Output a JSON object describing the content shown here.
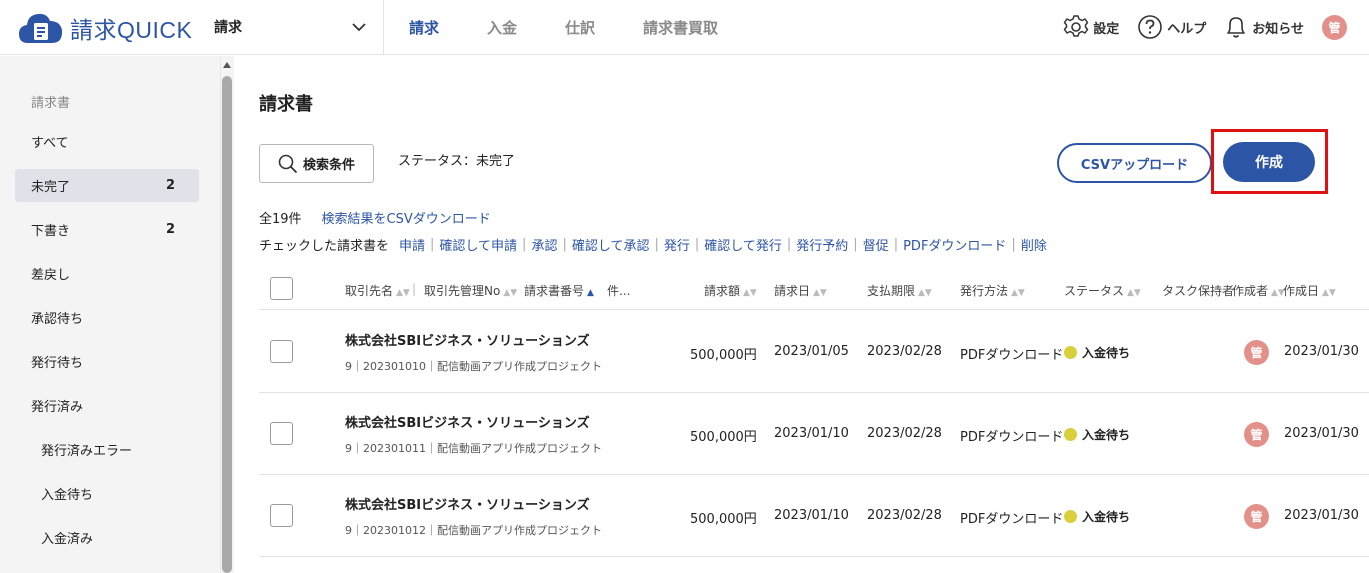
{
  "brand": {
    "name": "請求QUICK"
  },
  "app_select": {
    "label": "請求"
  },
  "nav": [
    {
      "label": "請求",
      "active": true
    },
    {
      "label": "入金",
      "active": false
    },
    {
      "label": "仕訳",
      "active": false
    },
    {
      "label": "請求書買取",
      "active": false
    }
  ],
  "top_right": {
    "settings": "設定",
    "help": "ヘルプ",
    "notifications": "お知らせ",
    "avatar": "管"
  },
  "sidebar": {
    "heading": "請求書",
    "items": [
      {
        "label": "すべて",
        "count": ""
      },
      {
        "label": "未完了",
        "count": "2",
        "active": true
      },
      {
        "label": "下書き",
        "count": "2"
      },
      {
        "label": "差戻し",
        "count": ""
      },
      {
        "label": "承認待ち",
        "count": ""
      },
      {
        "label": "発行待ち",
        "count": ""
      },
      {
        "label": "発行済み",
        "count": ""
      },
      {
        "label": "発行済みエラー",
        "count": "",
        "sub": true
      },
      {
        "label": "入金待ち",
        "count": "",
        "sub": true
      },
      {
        "label": "入金済み",
        "count": "",
        "sub": true
      }
    ]
  },
  "main": {
    "title": "請求書",
    "search_button": "検索条件",
    "status_filter": "ステータス：未完了",
    "csv_upload": "CSVアップロード",
    "create": "作成",
    "total": "全19件",
    "csv_download": "検索結果をCSVダウンロード",
    "bulk_lead": "チェックした請求書を",
    "bulk_actions": [
      "申請",
      "確認して申請",
      "承認",
      "確認して承認",
      "発行",
      "確認して発行",
      "発行予約",
      "督促",
      "PDFダウンロード",
      "削除"
    ]
  },
  "table": {
    "headers": {
      "client": "取引先名",
      "client_no": "取引先管理No",
      "invoice_no": "請求書番号",
      "subject": "件...",
      "amount": "請求額",
      "invoice_date": "請求日",
      "due_date": "支払期限",
      "method": "発行方法",
      "status": "ステータス",
      "task_holder": "タスク保持者",
      "creator": "作成者",
      "created": "作成日"
    },
    "rows": [
      {
        "client": "株式会社SBIビジネス・ソリューションズ",
        "sub": "9｜202301010｜配信動画アプリ作成プロジェクト",
        "amount": "500,000円",
        "invoice_date": "2023/01/05",
        "due_date": "2023/02/28",
        "method": "PDFダウンロード",
        "status": "入金待ち",
        "creator": "管",
        "created": "2023/01/30"
      },
      {
        "client": "株式会社SBIビジネス・ソリューションズ",
        "sub": "9｜202301011｜配信動画アプリ作成プロジェクト",
        "amount": "500,000円",
        "invoice_date": "2023/01/10",
        "due_date": "2023/02/28",
        "method": "PDFダウンロード",
        "status": "入金待ち",
        "creator": "管",
        "created": "2023/01/30"
      },
      {
        "client": "株式会社SBIビジネス・ソリューションズ",
        "sub": "9｜202301012｜配信動画アプリ作成プロジェクト",
        "amount": "500,000円",
        "invoice_date": "2023/01/10",
        "due_date": "2023/02/28",
        "method": "PDFダウンロード",
        "status": "入金待ち",
        "creator": "管",
        "created": "2023/01/30"
      }
    ]
  }
}
